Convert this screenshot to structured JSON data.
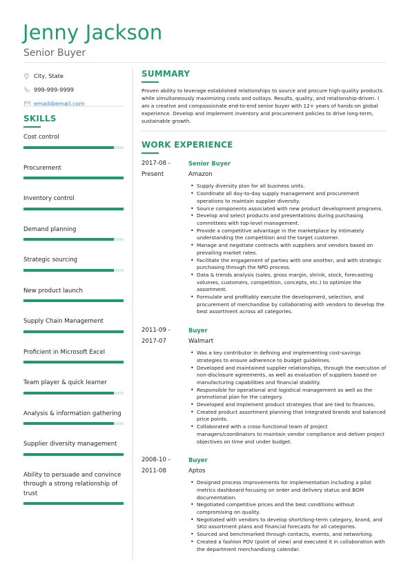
{
  "header": {
    "name": "Jenny Jackson",
    "title": "Senior Buyer"
  },
  "colors": {
    "accent": "#1f9a68",
    "bar_track": "#d6eee3",
    "link": "#3a7fc4",
    "divider": "#ececec"
  },
  "contact": {
    "location": {
      "icon": "map-pin-icon",
      "text": "City, State"
    },
    "phone": {
      "icon": "phone-icon",
      "text": "999-999-9999"
    },
    "email": {
      "icon": "envelope-icon",
      "text": "email@email.com"
    }
  },
  "skills": {
    "heading": "SKILLS",
    "items": [
      {
        "label": "Cost control",
        "level": 0.9
      },
      {
        "label": "Procurement",
        "level": 1.0
      },
      {
        "label": "Inventory control",
        "level": 1.0
      },
      {
        "label": "Demand planning",
        "level": 0.9
      },
      {
        "label": "Strategic sourcing",
        "level": 0.9
      },
      {
        "label": "New product launch",
        "level": 1.0
      },
      {
        "label": "Supply Chain Management",
        "level": 1.0
      },
      {
        "label": "Proficient in Microsoft Excel",
        "level": 1.0
      },
      {
        "label": "Team player & quick learner",
        "level": 0.9
      },
      {
        "label": "Analysis & information gathering",
        "level": 0.9
      },
      {
        "label": "Supplier diversity management",
        "level": 1.0
      },
      {
        "label": "Ability to persuade and convince through a strong relationship of trust",
        "level": 1.0
      }
    ]
  },
  "summary": {
    "heading": "SUMMARY",
    "text": "Proven ability to leverage established relationships to source and procure high-quality products while simultaneously maximizing costs and outlays. Results, quality, and relationship-driven. I am a creative and compassionate end-to-end senior buyer with 12+ years of hands-on global experience. Develop and implement inventory and procurement policies to drive long-term, sustainable growth."
  },
  "work": {
    "heading": "WORK EXPERIENCE",
    "jobs": [
      {
        "date_start": "2017-08 -",
        "date_end": "Present",
        "title": "Senior Buyer",
        "company": "Amazon",
        "bullets": [
          "Supply diversity plan for all business units.",
          "Coordinate all day-to-day supply management and procurement operations to maintain supplier diversity.",
          "Source components associated with new product development programs.",
          "Develop and select products and presentations during purchasing committees with top-level management.",
          "Provide a competitive advantage in the marketplace by intimately understanding the competition and the target customer.",
          "Manage and negotiate contracts with suppliers and vendors based on prevailing market rates.",
          "Facilitate the engagement of parties with one another, and with strategic purchasing through the NPD process.",
          "Data & trends analysis (sales, gross margin, shrink, stock, forecasting volumes, customers, competition, concepts, etc.) to optimize the assortment.",
          "Formulate and profitably execute the development, selection, and procurement of merchandise by collaborating with vendors to develop the best assortment across all categories."
        ]
      },
      {
        "date_start": "2011-09 -",
        "date_end": "2017-07",
        "title": "Buyer",
        "company": "Walmart",
        "bullets": [
          "Was a key contributor in defining and implementing cost-savings strategies to ensure adherence to budget guidelines.",
          "Developed and maintained supplier relationships, through the execution of non-disclosure agreements, as well as evaluation of suppliers based on manufacturing capabilities and financial stability.",
          "Responsible for operational and logistical management as well as the promotional plan for the category.",
          "Developed and implement product strategies that are tied to finances.",
          "Created product assortment planning that integrated brands and balanced price points.",
          "Collaborated with a cross-functional team of project managers/coordinators to maintain vendor compliance and deliver project objectives on time and under budget."
        ]
      },
      {
        "date_start": "2008-10 -",
        "date_end": "2011-08",
        "title": "Buyer",
        "company": "Aptos",
        "bullets": [
          "Designed process improvements for implementation including a pilot metrics dashboard focusing on order and delivery status and BOM documentation.",
          "Negotiated competitive prices and the best conditions without compromising on quality.",
          "Negotiated with vendors to develop short/long-term category, brand, and SKU assortment plans and financial forecasts for all categories.",
          "Sourced and benchmarked through contacts, events, and networking.",
          "Created a fashion POV (point of view) and executed it in collaboration with the department merchandising calendar."
        ]
      }
    ]
  }
}
